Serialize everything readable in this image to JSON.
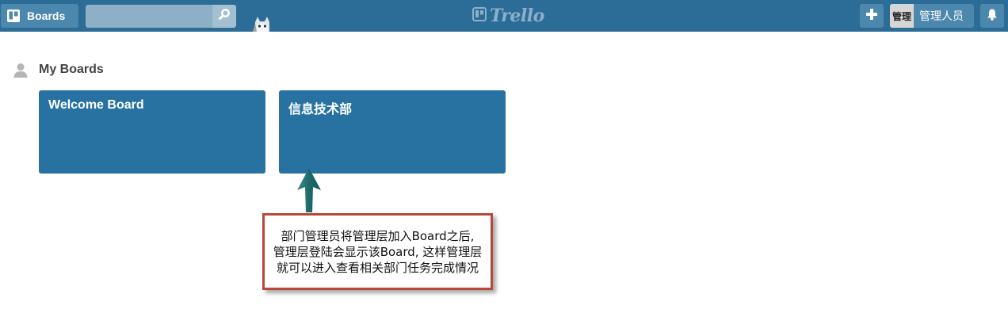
{
  "header": {
    "boards_label": "Boards",
    "search_placeholder": "",
    "logo_text": "Trello",
    "member_avatar": "管理",
    "member_name": "管理人员"
  },
  "section": {
    "title": "My Boards"
  },
  "boards": [
    {
      "name": "Welcome Board"
    },
    {
      "name": "信息技术部"
    }
  ],
  "annotation": {
    "lines": [
      "部门管理员将管理层加入Board之后,",
      "管理层登陆会显示该Board, 这样管理层",
      "就可以进入查看相关部门任务完成情况"
    ]
  },
  "colors": {
    "header_bg": "#2c6d97",
    "board_tile_bg": "#2872a2",
    "callout_border": "#b9483a",
    "arrow_color": "#1f6a6c"
  }
}
